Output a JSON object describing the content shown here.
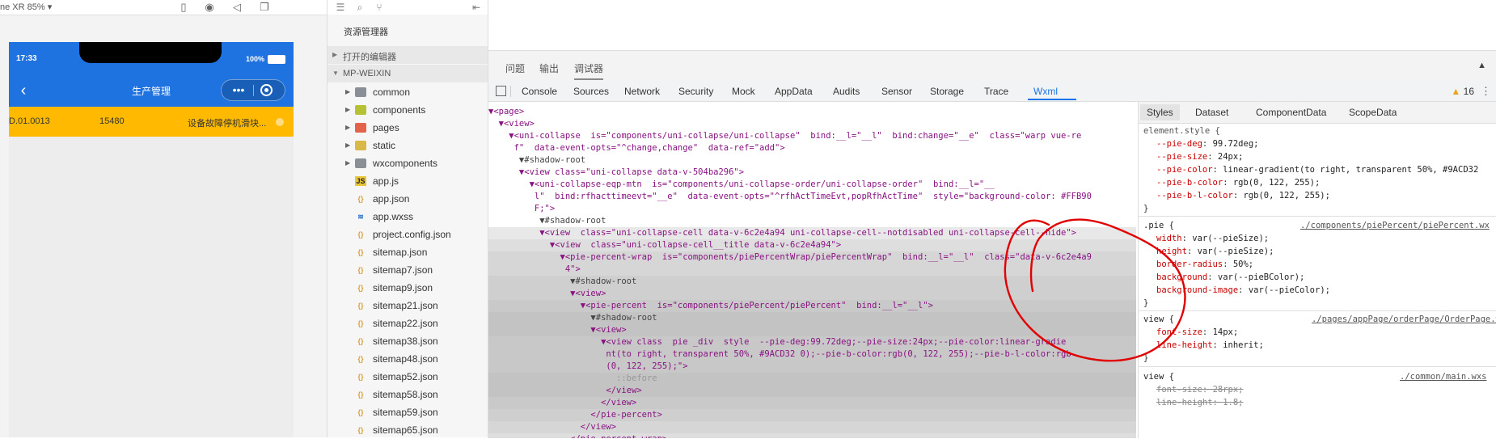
{
  "simulator": {
    "device_label": "ne XR 85% ▾",
    "time": "17:33",
    "battery": "100%",
    "nav_title": "生产管理",
    "capsule_more": "•••",
    "row": {
      "code": "D.01.0013",
      "number": "15480",
      "desc": "设备故障停机滑块..."
    }
  },
  "explorer": {
    "title": "资源管理器",
    "section_open_editors": "打开的编辑器",
    "section_project": "MP-WEIXIN",
    "items": [
      {
        "name": "common",
        "type": "folder"
      },
      {
        "name": "components",
        "type": "folder-comp"
      },
      {
        "name": "pages",
        "type": "folder-pages"
      },
      {
        "name": "static",
        "type": "folder-static"
      },
      {
        "name": "wxcomponents",
        "type": "folder"
      },
      {
        "name": "app.js",
        "type": "js"
      },
      {
        "name": "app.json",
        "type": "json"
      },
      {
        "name": "app.wxss",
        "type": "wxss"
      },
      {
        "name": "project.config.json",
        "type": "json"
      },
      {
        "name": "sitemap.json",
        "type": "json"
      },
      {
        "name": "sitemap7.json",
        "type": "json"
      },
      {
        "name": "sitemap9.json",
        "type": "json"
      },
      {
        "name": "sitemap21.json",
        "type": "json"
      },
      {
        "name": "sitemap22.json",
        "type": "json"
      },
      {
        "name": "sitemap38.json",
        "type": "json"
      },
      {
        "name": "sitemap48.json",
        "type": "json"
      },
      {
        "name": "sitemap52.json",
        "type": "json"
      },
      {
        "name": "sitemap58.json",
        "type": "json"
      },
      {
        "name": "sitemap59.json",
        "type": "json"
      },
      {
        "name": "sitemap65.json",
        "type": "json"
      }
    ]
  },
  "devtools": {
    "top_tabs": [
      "问题",
      "输出",
      "调试器"
    ],
    "panel_tabs": [
      "Console",
      "Sources",
      "Network",
      "Security",
      "Mock",
      "AppData",
      "Audits",
      "Sensor",
      "Storage",
      "Trace",
      "Wxml"
    ],
    "warn_count": "16",
    "styles_tabs": [
      "Styles",
      "Dataset",
      "ComponentData",
      "ScopeData"
    ],
    "code_lines": [
      "▼<page>",
      "  ▼<view>",
      "    ▼<uni-collapse  is=\"components/uni-collapse/uni-collapse\"  bind:__l=\"__l\"  bind:change=\"__e\"  class=\"warp vue-re",
      "     f\"  data-event-opts=\"^change,change\"  data-ref=\"add\">",
      "      ▼#shadow-root",
      "      ▼<view class=\"uni-collapse data-v-504ba296\">",
      "        ▼<uni-collapse-eqp-mtn  is=\"components/uni-collapse-order/uni-collapse-order\"  bind:__l=\"__",
      "         l\"  bind:rfhacttimeevt=\"__e\"  data-event-opts=\"^rfhActTimeEvt,popRfhActTime\"  style=\"background-color: #FFB90",
      "         F;\">",
      "          ▼#shadow-root",
      "          ▼<view  class=\"uni-collapse-cell data-v-6c2e4a94 uni-collapse-cell--notdisabled uni-collapse-cell--hide\">",
      "            ▼<view  class=\"uni-collapse-cell__title data-v-6c2e4a94\">",
      "              ▼<pie-percent-wrap  is=\"components/piePercentWrap/piePercentWrap\"  bind:__l=\"__l\"  class=\"data-v-6c2e4a9",
      "               4\">",
      "                ▼#shadow-root",
      "                ▼<view>",
      "                  ▼<pie-percent  is=\"components/piePercent/piePercent\"  bind:__l=\"__l\">",
      "                    ▼#shadow-root",
      "                    ▼<view>",
      "                      ▼<view class  pie _div  style  --pie-deg:99.72deg;--pie-size:24px;--pie-color:linear-gradie",
      "                       nt(to right, transparent 50%, #9ACD32 0);--pie-b-color:rgb(0, 122, 255);--pie-b-l-color:rgb",
      "                       (0, 122, 255);\">",
      "                         ::before",
      "                       </view>",
      "                      </view>",
      "                    </pie-percent>",
      "                  </view>",
      "                </pie-percent-wrap>"
    ],
    "styles": {
      "element_style_selector": "element.style {",
      "element_style": [
        {
          "prop": "--pie-deg",
          "val": "99.72deg;"
        },
        {
          "prop": "--pie-size",
          "val": "24px;"
        },
        {
          "prop": "--pie-color",
          "val": "linear-gradient(to right, transparent 50%, #9ACD32"
        },
        {
          "prop": "--pie-b-color",
          "val": "rgb(0, 122, 255);"
        },
        {
          "prop": "--pie-b-l-color",
          "val": "rgb(0, 122, 255);"
        }
      ],
      "pie_selector": ".pie {",
      "pie_source": "./components/piePercent/piePercent.wx",
      "pie_rules": [
        {
          "prop": "width",
          "val": "var(--pieSize);"
        },
        {
          "prop": "height",
          "val": "var(--pieSize);"
        },
        {
          "prop": "border-radius",
          "val": "50%;"
        },
        {
          "prop": "background",
          "val": "var(--pieBColor);"
        },
        {
          "prop": "background-image",
          "val": "var(--pieColor);"
        }
      ],
      "view1_selector": "view {",
      "view1_source": "./pages/appPage/orderPage/OrderPage.wxs",
      "view1_rules": [
        {
          "prop": "font-size",
          "val": "14px;"
        },
        {
          "prop": "line-height",
          "val": "inherit;"
        }
      ],
      "view2_selector": "view {",
      "view2_source": "./common/main.wxs",
      "view2_rules": [
        {
          "prop": "font-size",
          "val": "28rpx;"
        },
        {
          "prop": "line-height",
          "val": "1.8;"
        }
      ],
      "close_brace": "}"
    }
  },
  "colors": {
    "accent_blue": "#1f73e0",
    "row_yellow": "#FFB900",
    "wxml_tab": "#1a73e8",
    "annotation_red": "#e00000"
  }
}
